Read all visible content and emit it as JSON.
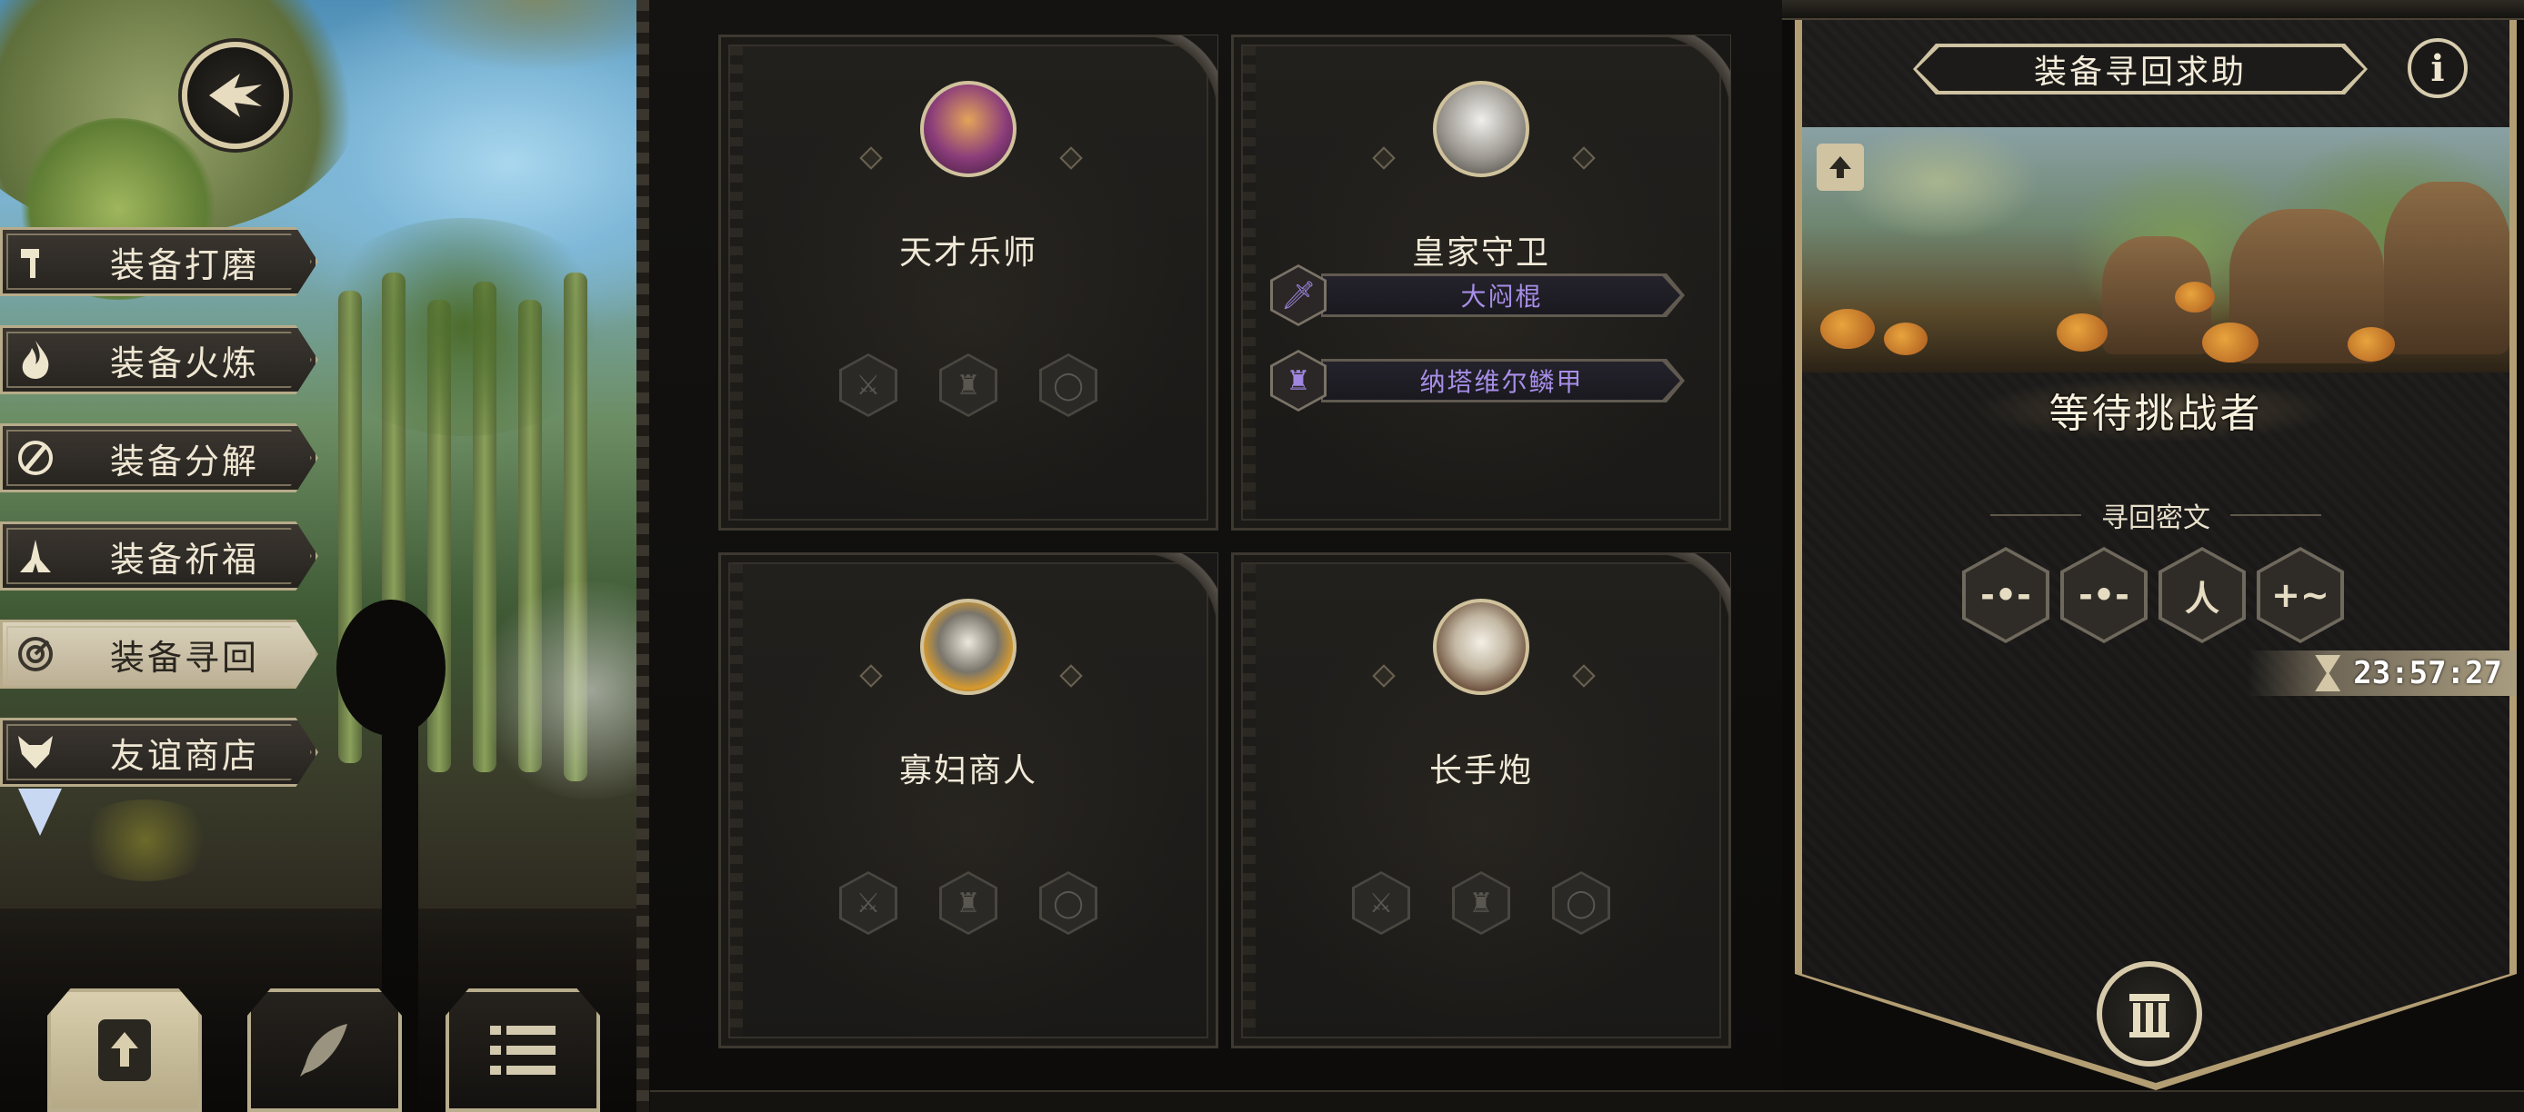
{
  "sidebar": {
    "items": [
      {
        "label": "装备打磨",
        "icon": "hammer-icon"
      },
      {
        "label": "装备火炼",
        "icon": "flame-icon"
      },
      {
        "label": "装备分解",
        "icon": "disassemble-icon"
      },
      {
        "label": "装备祈福",
        "icon": "pray-hands-icon"
      },
      {
        "label": "装备寻回",
        "icon": "target-icon",
        "active": true
      },
      {
        "label": "友谊商店",
        "icon": "fox-icon"
      }
    ]
  },
  "bottom_tabs": [
    {
      "icon": "upload-document-icon",
      "active": true
    },
    {
      "icon": "feather-icon",
      "active": false
    },
    {
      "icon": "list-icon",
      "active": false
    }
  ],
  "heroes": [
    {
      "name": "天才乐师",
      "equipment": []
    },
    {
      "name": "皇家守卫",
      "equipment": [
        {
          "label": "大闷棍",
          "icon": "sword-icon"
        },
        {
          "label": "纳塔维尔鳞甲",
          "icon": "armor-icon"
        }
      ]
    },
    {
      "name": "寡妇商人",
      "equipment": []
    },
    {
      "name": "长手炮",
      "equipment": []
    }
  ],
  "right_panel": {
    "title": "装备寻回求助",
    "info_label": "i",
    "status": "等待挑战者",
    "cipher_label": "寻回密文",
    "cipher_symbols": [
      "-•-",
      "-•-",
      "人",
      "+~"
    ],
    "timer": "23:57:27"
  },
  "colors": {
    "accent_gold": "#d0c29c",
    "equipment_purple": "#a78ee8",
    "panel_dark": "#1d1c1b"
  }
}
